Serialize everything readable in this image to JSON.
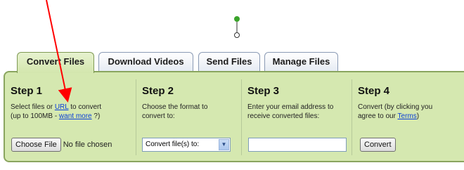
{
  "tabs": [
    {
      "label": "Convert Files",
      "active": true
    },
    {
      "label": "Download Videos",
      "active": false
    },
    {
      "label": "Send Files",
      "active": false
    },
    {
      "label": "Manage Files",
      "active": false
    }
  ],
  "steps": {
    "step1": {
      "title": "Step 1",
      "text_a": "Select files or ",
      "url_link": "URL",
      "text_b": " to convert",
      "text_c": "(up to 100MB - ",
      "want_more_link": "want more",
      "text_d": " ?)",
      "choose_button": "Choose File",
      "no_file": "No file chosen"
    },
    "step2": {
      "title": "Step 2",
      "line1": "Choose the format to",
      "line2": "convert to:",
      "select_value": "Convert file(s) to:"
    },
    "step3": {
      "title": "Step 3",
      "line1": "Enter your email address to",
      "line2": "receive converted files:",
      "email_value": ""
    },
    "step4": {
      "title": "Step 4",
      "line1": "Convert (by clicking you",
      "text_a": "agree to our ",
      "terms_link": "Terms",
      "text_b": ")",
      "convert_button": "Convert"
    }
  },
  "annotation": {
    "arrow_color": "#ff0000",
    "marker_color": "#3aa32a"
  }
}
